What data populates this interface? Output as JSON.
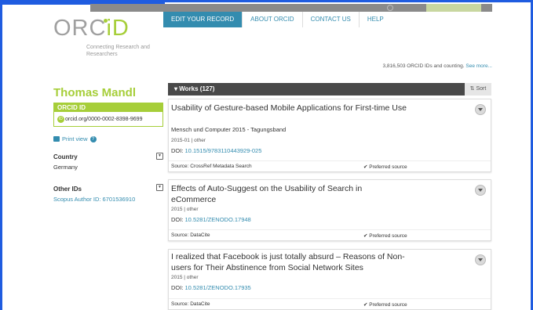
{
  "header": {
    "logo_main": "ORC",
    "logo_id": "iD",
    "tagline": "Connecting Research and Researchers",
    "nav": [
      "EDIT YOUR RECORD",
      "ABOUT ORCID",
      "CONTACT US",
      "HELP"
    ],
    "count_text": "3,816,503 ORCID IDs and counting.",
    "count_link": "See more..."
  },
  "profile": {
    "name": "Thomas Mandl",
    "orcid_label": "ORCID ID",
    "orcid_value": "orcid.org/0000-0002-8398-9699",
    "print_view": "Print view",
    "country_label": "Country",
    "country_value": "Germany",
    "other_ids_label": "Other IDs",
    "other_ids_value": "Scopus Author ID: 6701536910"
  },
  "works": {
    "title": "Works (127)",
    "sort_label": "Sort",
    "items": [
      {
        "title": "Usability of Gesture-based Mobile Applications for First-time Use",
        "subtitle": "Mensch und Computer 2015 - Tagungsband",
        "meta": "2015-01 | other",
        "doi_label": "DOI:",
        "doi": "10.1515/9783110443929-025",
        "source": "Source: CrossRef Metadata Search",
        "preferred": "Preferred source"
      },
      {
        "title": "Effects of Auto-Suggest on the Usability of Search in eCommerce",
        "subtitle": "",
        "meta": "2015 | other",
        "doi_label": "DOI:",
        "doi": "10.5281/ZENODO.17948",
        "source": "Source: DataCite",
        "preferred": "Preferred source"
      },
      {
        "title": "I realized that Facebook is just totally absurd – Reasons of Non-users for Their Abstinence from Social Network Sites",
        "subtitle": "",
        "meta": "2015 | other",
        "doi_label": "DOI:",
        "doi": "10.5281/ZENODO.17935",
        "source": "Source: DataCite",
        "preferred": "Preferred source"
      }
    ]
  },
  "colors": {
    "brand_green": "#a6ce39",
    "link_blue": "#338caf",
    "works_bar": "#494949"
  }
}
